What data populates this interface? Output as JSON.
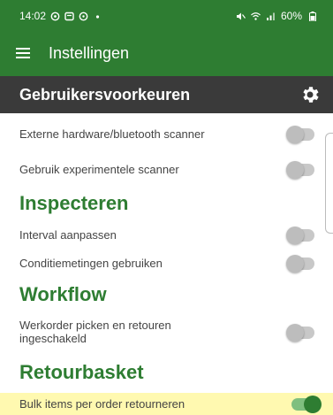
{
  "status_bar": {
    "time": "14:02",
    "left_icons": [
      "whatsapp-icon",
      "message-icon",
      "notification-icon",
      "dot-icon"
    ],
    "battery": "60%"
  },
  "app_bar": {
    "title": "Instellingen"
  },
  "section": {
    "title": "Gebruikersvoorkeuren"
  },
  "settings": [
    {
      "label": "Externe hardware/bluetooth scanner",
      "enabled": false
    },
    {
      "label": "Gebruik experimentele scanner",
      "enabled": false
    }
  ],
  "groups": {
    "inspecteren": {
      "title": "Inspecteren",
      "items": [
        {
          "label": "Interval aanpassen",
          "enabled": false
        },
        {
          "label": "Conditiemetingen gebruiken",
          "enabled": false
        }
      ]
    },
    "workflow": {
      "title": "Workflow",
      "items": [
        {
          "label_line1": "Werkorder picken en retouren",
          "label_line2": "ingeschakeld",
          "enabled": false
        }
      ]
    },
    "retourbasket": {
      "title": "Retourbasket",
      "items": [
        {
          "label": "Bulk items per order retourneren",
          "enabled": true
        }
      ]
    }
  },
  "colors": {
    "primary": "#2e7d32",
    "header_dark": "#3a3a3a",
    "highlight": "#fff9b0"
  }
}
